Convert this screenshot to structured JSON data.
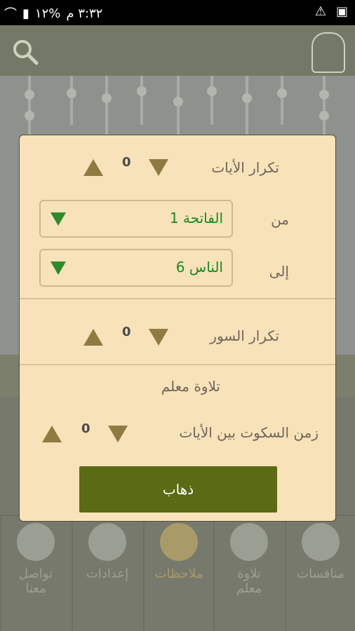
{
  "status_bar": {
    "time": "٣:٣٢ م",
    "battery": "%١٢"
  },
  "dialog": {
    "verse_repeat": {
      "label": "تكرار الأيات",
      "count": "0"
    },
    "from": {
      "label": "من",
      "value": "الفاتحة 1"
    },
    "to": {
      "label": "إلى",
      "value": "الناس 6"
    },
    "surah_repeat": {
      "label": "تكرار السور",
      "count": "0"
    },
    "teacher_recitation": "تلاوة معلم",
    "silence": {
      "label": "زمن السكوت بين الأيات",
      "count": "0"
    },
    "go_label": "ذهاب"
  },
  "grid": {
    "bottom_row": [
      {
        "label": "منافسات",
        "icon": "trophy-icon"
      },
      {
        "label": "تلاوة\nمعلم",
        "icon": "teacher-icon"
      },
      {
        "label": "ملاحظات",
        "icon": "note-icon"
      },
      {
        "label": "إعدادات",
        "icon": "gear-icon"
      },
      {
        "label": "تواصل\nمعنا",
        "icon": "info-icon"
      }
    ]
  }
}
